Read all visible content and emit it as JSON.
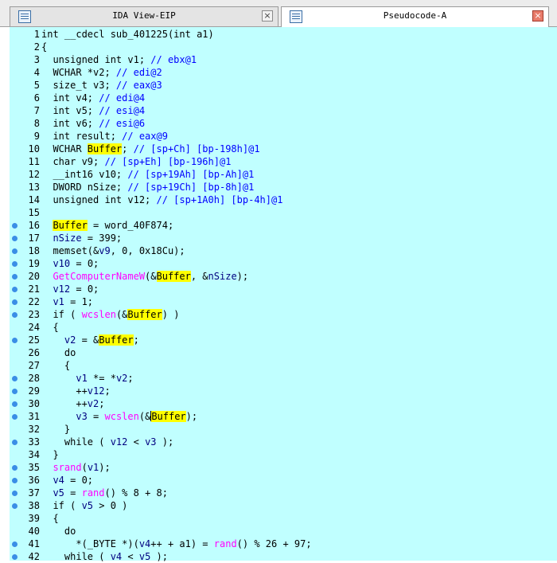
{
  "tabs": [
    {
      "label": "IDA View-EIP",
      "active": false
    },
    {
      "label": "Pseudocode-A",
      "active": true
    }
  ],
  "colors": {
    "editor_bg": "#c0ffff",
    "highlight": "#ffff00",
    "comment": "#0000ff",
    "function": "#ff00ff",
    "variable": "#000080",
    "breakpoint_dot": "#3a8ee6"
  },
  "icons": {
    "tab": "document-list-icon",
    "close": "close-icon",
    "dot": "executable-line-dot-icon"
  },
  "lines": [
    {
      "n": "1",
      "dot": false,
      "t": [
        [
          "k",
          "int __cdecl sub_401225(int a1)"
        ]
      ]
    },
    {
      "n": "2",
      "dot": false,
      "t": [
        [
          "k",
          "{"
        ]
      ]
    },
    {
      "n": "3",
      "dot": false,
      "t": [
        [
          "k",
          "  unsigned int v1; "
        ],
        [
          "c",
          "// ebx@1"
        ]
      ]
    },
    {
      "n": "4",
      "dot": false,
      "t": [
        [
          "k",
          "  WCHAR *v2; "
        ],
        [
          "c",
          "// edi@2"
        ]
      ]
    },
    {
      "n": "5",
      "dot": false,
      "t": [
        [
          "k",
          "  size_t v3; "
        ],
        [
          "c",
          "// eax@3"
        ]
      ]
    },
    {
      "n": "6",
      "dot": false,
      "t": [
        [
          "k",
          "  int v4; "
        ],
        [
          "c",
          "// edi@4"
        ]
      ]
    },
    {
      "n": "7",
      "dot": false,
      "t": [
        [
          "k",
          "  int v5; "
        ],
        [
          "c",
          "// esi@4"
        ]
      ]
    },
    {
      "n": "8",
      "dot": false,
      "t": [
        [
          "k",
          "  int v6; "
        ],
        [
          "c",
          "// esi@6"
        ]
      ]
    },
    {
      "n": "9",
      "dot": false,
      "t": [
        [
          "k",
          "  int result; "
        ],
        [
          "c",
          "// eax@9"
        ]
      ]
    },
    {
      "n": "10",
      "dot": false,
      "t": [
        [
          "k",
          "  WCHAR "
        ],
        [
          "hl",
          "Buffer"
        ],
        [
          "k",
          "; "
        ],
        [
          "c",
          "// [sp+Ch] [bp-198h]@1"
        ]
      ]
    },
    {
      "n": "11",
      "dot": false,
      "t": [
        [
          "k",
          "  char v9; "
        ],
        [
          "c",
          "// [sp+Eh] [bp-196h]@1"
        ]
      ]
    },
    {
      "n": "12",
      "dot": false,
      "t": [
        [
          "k",
          "  __int16 v10; "
        ],
        [
          "c",
          "// [sp+19Ah] [bp-Ah]@1"
        ]
      ]
    },
    {
      "n": "13",
      "dot": false,
      "t": [
        [
          "k",
          "  DWORD nSize; "
        ],
        [
          "c",
          "// [sp+19Ch] [bp-8h]@1"
        ]
      ]
    },
    {
      "n": "14",
      "dot": false,
      "t": [
        [
          "k",
          "  unsigned int v12; "
        ],
        [
          "c",
          "// [sp+1A0h] [bp-4h]@1"
        ]
      ]
    },
    {
      "n": "15",
      "dot": false,
      "t": [
        [
          "k",
          ""
        ]
      ]
    },
    {
      "n": "16",
      "dot": true,
      "t": [
        [
          "k",
          "  "
        ],
        [
          "hl",
          "Buffer"
        ],
        [
          "k",
          " = word_40F874;"
        ]
      ]
    },
    {
      "n": "17",
      "dot": true,
      "t": [
        [
          "k",
          "  "
        ],
        [
          "v",
          "nSize"
        ],
        [
          "k",
          " = 399;"
        ]
      ]
    },
    {
      "n": "18",
      "dot": true,
      "t": [
        [
          "k",
          "  memset(&"
        ],
        [
          "v",
          "v9"
        ],
        [
          "k",
          ", 0, 0x18Cu);"
        ]
      ]
    },
    {
      "n": "19",
      "dot": true,
      "t": [
        [
          "k",
          "  "
        ],
        [
          "v",
          "v10"
        ],
        [
          "k",
          " = 0;"
        ]
      ]
    },
    {
      "n": "20",
      "dot": true,
      "t": [
        [
          "k",
          "  "
        ],
        [
          "f",
          "GetComputerNameW"
        ],
        [
          "k",
          "(&"
        ],
        [
          "hl",
          "Buffer"
        ],
        [
          "k",
          ", &"
        ],
        [
          "v",
          "nSize"
        ],
        [
          "k",
          ");"
        ]
      ]
    },
    {
      "n": "21",
      "dot": true,
      "t": [
        [
          "k",
          "  "
        ],
        [
          "v",
          "v12"
        ],
        [
          "k",
          " = 0;"
        ]
      ]
    },
    {
      "n": "22",
      "dot": true,
      "t": [
        [
          "k",
          "  "
        ],
        [
          "v",
          "v1"
        ],
        [
          "k",
          " = 1;"
        ]
      ]
    },
    {
      "n": "23",
      "dot": true,
      "t": [
        [
          "k",
          "  if ( "
        ],
        [
          "f",
          "wcslen"
        ],
        [
          "k",
          "(&"
        ],
        [
          "hl",
          "Buffer"
        ],
        [
          "k",
          ") )"
        ]
      ]
    },
    {
      "n": "24",
      "dot": false,
      "t": [
        [
          "k",
          "  {"
        ]
      ]
    },
    {
      "n": "25",
      "dot": true,
      "t": [
        [
          "k",
          "    "
        ],
        [
          "v",
          "v2"
        ],
        [
          "k",
          " = &"
        ],
        [
          "hl",
          "Buffer"
        ],
        [
          "k",
          ";"
        ]
      ]
    },
    {
      "n": "26",
      "dot": false,
      "t": [
        [
          "k",
          "    do"
        ]
      ]
    },
    {
      "n": "27",
      "dot": false,
      "t": [
        [
          "k",
          "    {"
        ]
      ]
    },
    {
      "n": "28",
      "dot": true,
      "t": [
        [
          "k",
          "      "
        ],
        [
          "v",
          "v1"
        ],
        [
          "k",
          " *= *"
        ],
        [
          "v",
          "v2"
        ],
        [
          "k",
          ";"
        ]
      ]
    },
    {
      "n": "29",
      "dot": true,
      "t": [
        [
          "k",
          "      ++"
        ],
        [
          "v",
          "v12"
        ],
        [
          "k",
          ";"
        ]
      ]
    },
    {
      "n": "30",
      "dot": true,
      "t": [
        [
          "k",
          "      ++"
        ],
        [
          "v",
          "v2"
        ],
        [
          "k",
          ";"
        ]
      ]
    },
    {
      "n": "31",
      "dot": true,
      "t": [
        [
          "k",
          "      "
        ],
        [
          "v",
          "v3"
        ],
        [
          "k",
          " = "
        ],
        [
          "f",
          "wcslen"
        ],
        [
          "k",
          "(&"
        ],
        [
          "caret",
          ""
        ],
        [
          "hl",
          "Buffer"
        ],
        [
          "k",
          ");"
        ]
      ]
    },
    {
      "n": "32",
      "dot": false,
      "t": [
        [
          "k",
          "    }"
        ]
      ]
    },
    {
      "n": "33",
      "dot": true,
      "t": [
        [
          "k",
          "    while ( "
        ],
        [
          "v",
          "v12"
        ],
        [
          "k",
          " < "
        ],
        [
          "v",
          "v3"
        ],
        [
          "k",
          " );"
        ]
      ]
    },
    {
      "n": "34",
      "dot": false,
      "t": [
        [
          "k",
          "  }"
        ]
      ]
    },
    {
      "n": "35",
      "dot": true,
      "t": [
        [
          "k",
          "  "
        ],
        [
          "f",
          "srand"
        ],
        [
          "k",
          "("
        ],
        [
          "v",
          "v1"
        ],
        [
          "k",
          ");"
        ]
      ]
    },
    {
      "n": "36",
      "dot": true,
      "t": [
        [
          "k",
          "  "
        ],
        [
          "v",
          "v4"
        ],
        [
          "k",
          " = 0;"
        ]
      ]
    },
    {
      "n": "37",
      "dot": true,
      "t": [
        [
          "k",
          "  "
        ],
        [
          "v",
          "v5"
        ],
        [
          "k",
          " = "
        ],
        [
          "f",
          "rand"
        ],
        [
          "k",
          "() % 8 + 8;"
        ]
      ]
    },
    {
      "n": "38",
      "dot": true,
      "t": [
        [
          "k",
          "  if ( "
        ],
        [
          "v",
          "v5"
        ],
        [
          "k",
          " > 0 )"
        ]
      ]
    },
    {
      "n": "39",
      "dot": false,
      "t": [
        [
          "k",
          "  {"
        ]
      ]
    },
    {
      "n": "40",
      "dot": false,
      "t": [
        [
          "k",
          "    do"
        ]
      ]
    },
    {
      "n": "41",
      "dot": true,
      "t": [
        [
          "k",
          "      *(_BYTE *)("
        ],
        [
          "v",
          "v4"
        ],
        [
          "k",
          "++ + a1) = "
        ],
        [
          "f",
          "rand"
        ],
        [
          "k",
          "() % 26 + 97;"
        ]
      ]
    },
    {
      "n": "42",
      "dot": true,
      "t": [
        [
          "k",
          "    while ( "
        ],
        [
          "v",
          "v4"
        ],
        [
          "k",
          " < "
        ],
        [
          "v",
          "v5"
        ],
        [
          "k",
          " );"
        ]
      ]
    }
  ]
}
